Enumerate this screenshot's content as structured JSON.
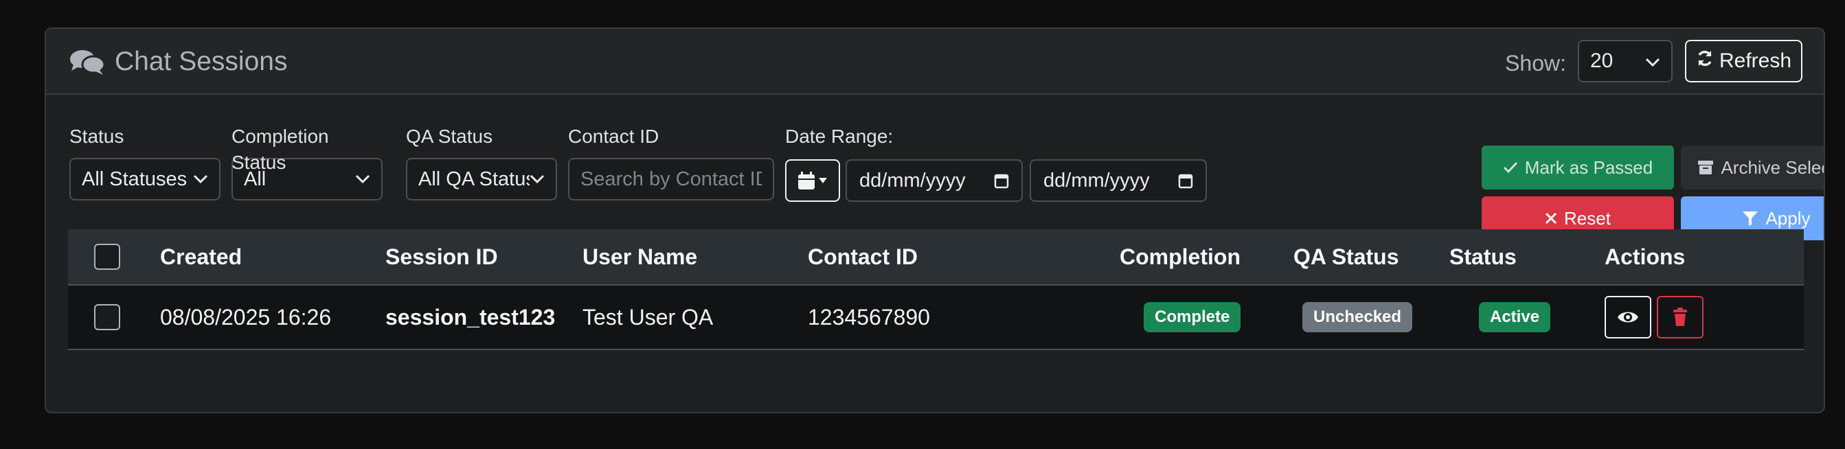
{
  "header": {
    "title": "Chat Sessions",
    "show_label": "Show:",
    "show_value": "20",
    "refresh_label": "Refresh"
  },
  "filters": {
    "status": {
      "label": "Status",
      "value": "All Statuses"
    },
    "completion": {
      "label": "Completion Status",
      "value": "All"
    },
    "qa": {
      "label": "QA Status",
      "value": "All QA Statuses"
    },
    "contact": {
      "label": "Contact ID",
      "placeholder": "Search by Contact ID"
    },
    "date_range": {
      "label": "Date Range:",
      "start": "dd/mm/yyyy",
      "end": "dd/mm/yyyy"
    }
  },
  "actions": {
    "mark_passed": "Mark as Passed",
    "archive": "Archive Selected",
    "reset": "Reset",
    "apply": "Apply"
  },
  "table": {
    "columns": {
      "created": "Created",
      "session_id": "Session ID",
      "user_name": "User Name",
      "contact_id": "Contact ID",
      "completion": "Completion",
      "qa_status": "QA Status",
      "status": "Status",
      "actions": "Actions"
    },
    "rows": [
      {
        "created": "08/08/2025 16:26",
        "session_id": "session_test123",
        "user_name": "Test User QA",
        "contact_id": "1234567890",
        "completion": "Complete",
        "qa_status": "Unchecked",
        "status": "Active"
      }
    ]
  },
  "colors": {
    "success": "#198754",
    "danger": "#dc3545",
    "primary_light": "#6ea8fe",
    "secondary": "#6c757d"
  }
}
